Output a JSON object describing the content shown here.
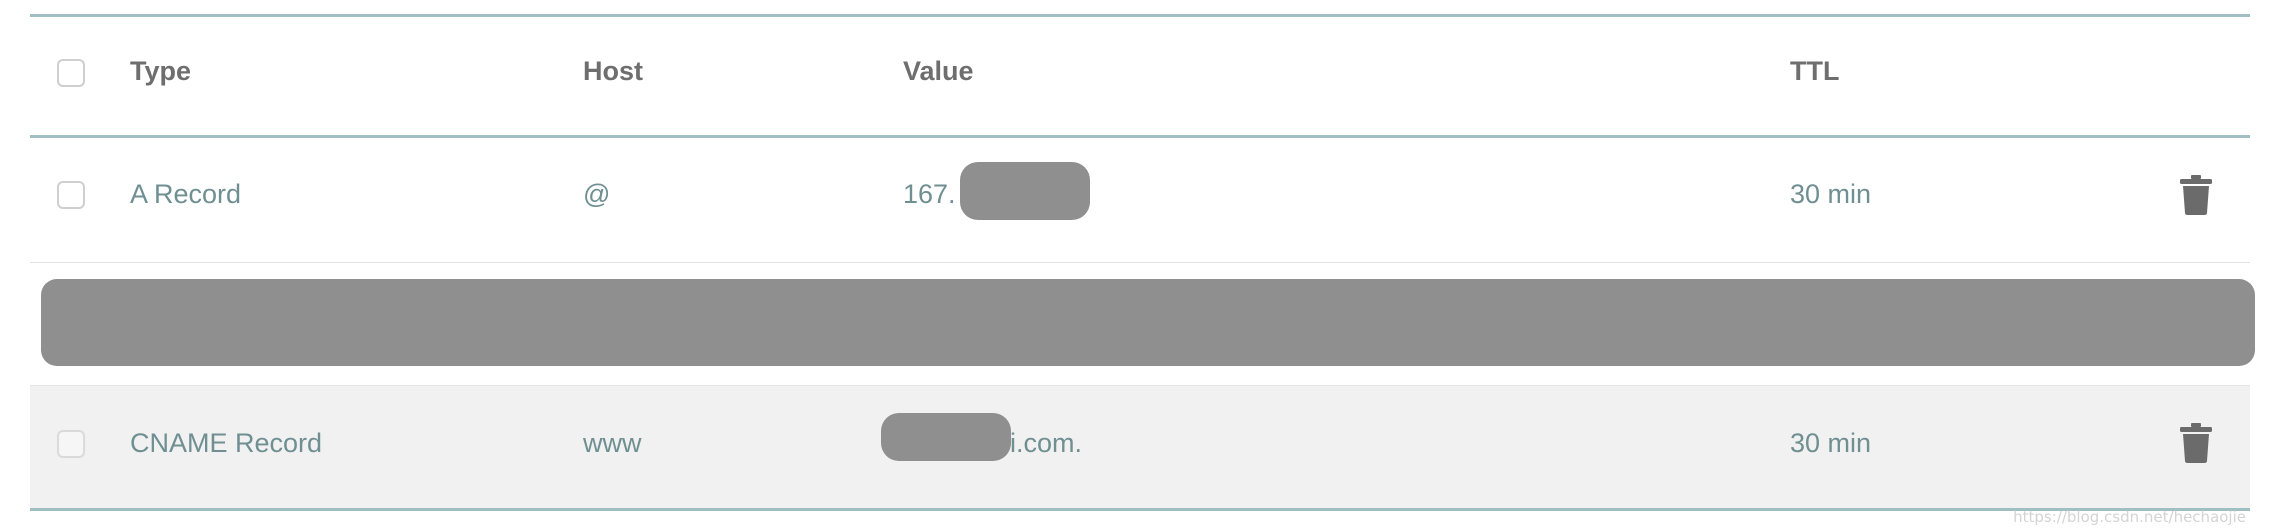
{
  "header": {
    "type": "Type",
    "host": "Host",
    "value": "Value",
    "ttl": "TTL"
  },
  "rows": [
    {
      "type": "A Record",
      "host": "@",
      "value_visible": "167.",
      "ttl": "30 min",
      "value_redacted": true
    },
    {
      "redacted_row": true
    },
    {
      "type": "CNAME Record",
      "host": "www",
      "value_visible": "i.com.",
      "ttl": "30 min",
      "value_redacted": true
    }
  ],
  "icons": {
    "delete": "trash-icon",
    "checkbox": "checkbox"
  },
  "colors": {
    "accent_rule": "#9fbfc3",
    "row_text": "#6f8f92",
    "header_text": "#6e6e6e",
    "redaction": "#8f8f8f"
  },
  "watermark": "https://blog.csdn.net/hechaojie"
}
